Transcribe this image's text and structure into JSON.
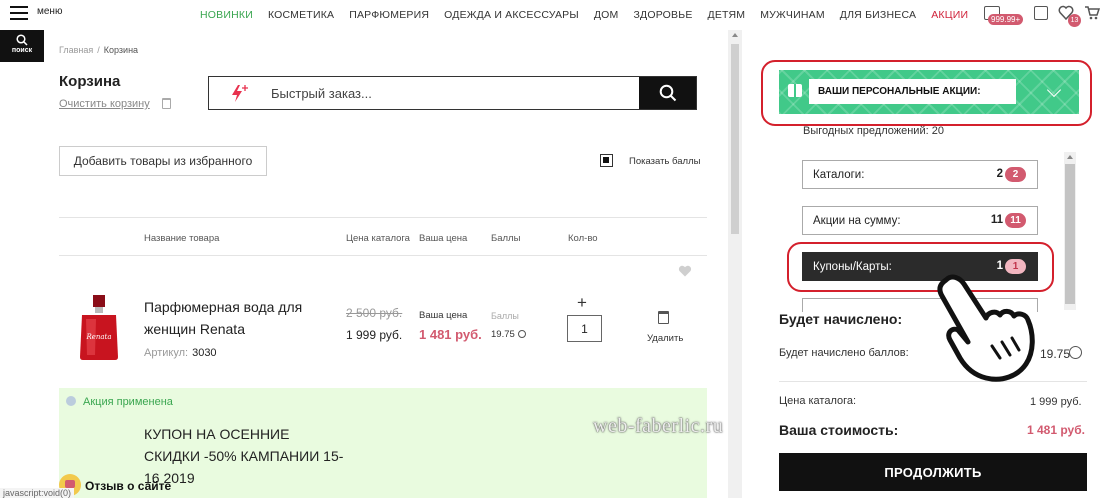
{
  "header": {
    "menu_label": "меню",
    "search_label": "поиск",
    "nav": [
      "НОВИНКИ",
      "КОСМЕТИКА",
      "ПАРФЮМЕРИЯ",
      "ОДЕЖДА И АКСЕССУАРЫ",
      "ДОМ",
      "ЗДОРОВЬЕ",
      "ДЕТЯМ",
      "МУЖЧИНАМ",
      "ДЛЯ БИЗНЕСА",
      "АКЦИИ"
    ],
    "wallet_badge": "999.99+",
    "cart_badge": "13",
    "accent_green": "#3aa650",
    "accent_red": "#d0243c"
  },
  "breadcrumb": {
    "home": "Главная",
    "sep": "/",
    "current": "Корзина"
  },
  "cart": {
    "title": "Корзина",
    "clear_label": "Очистить корзину",
    "quick_order_placeholder": "Быстрый заказ...",
    "add_from_favorites": "Добавить товары из избранного",
    "show_points": "Показать баллы",
    "columns": {
      "name": "Название товара",
      "catalog_price": "Цена каталога",
      "your_price": "Ваша цена",
      "points": "Баллы",
      "qty": "Кол-во"
    },
    "item": {
      "name": "Парфюмерная вода для женщин Renata",
      "article_label": "Артикул:",
      "article": "3030",
      "old_price": "2 500 руб.",
      "catalog_price": "1 999 руб.",
      "your_price_label": "Ваша цена",
      "your_price": "1 481 руб.",
      "points_label": "Баллы",
      "points": "19.75",
      "qty": "1",
      "delete_label": "Удалить"
    },
    "promo_applied": "Акция применена",
    "promo_text": "КУПОН НА ОСЕННИЕ СКИДКИ -50% КАМПАНИИ 15-16 2019"
  },
  "feedback_label": "Отзыв о сайте",
  "status_text": "javascript:void(0)",
  "sidebar": {
    "personal_promos": "ВАШИ ПЕРСОНАЛЬНЫЕ АКЦИИ:",
    "offers_count": "Выгодных предложений: 20",
    "offers": [
      {
        "label": "Каталоги:",
        "count": "2",
        "badge": "2"
      },
      {
        "label": "Акции на сумму:",
        "count": "11",
        "badge": "11"
      },
      {
        "label": "Купоны/Карты:",
        "count": "1",
        "badge": "1"
      }
    ],
    "accrued_title": "Будет начислено:",
    "accrued_points_label": "Будет начислено баллов:",
    "accrued_points": "19.75",
    "catalog_price_label": "Цена каталога:",
    "catalog_price": "1 999 руб.",
    "total_label": "Ваша стоимость:",
    "total": "1 481 руб.",
    "continue_label": "ПРОДОЛЖИТЬ",
    "promo_green": "#41c989",
    "badge_pink": "#d25a6f"
  },
  "watermark": "web-faberlic.ru"
}
